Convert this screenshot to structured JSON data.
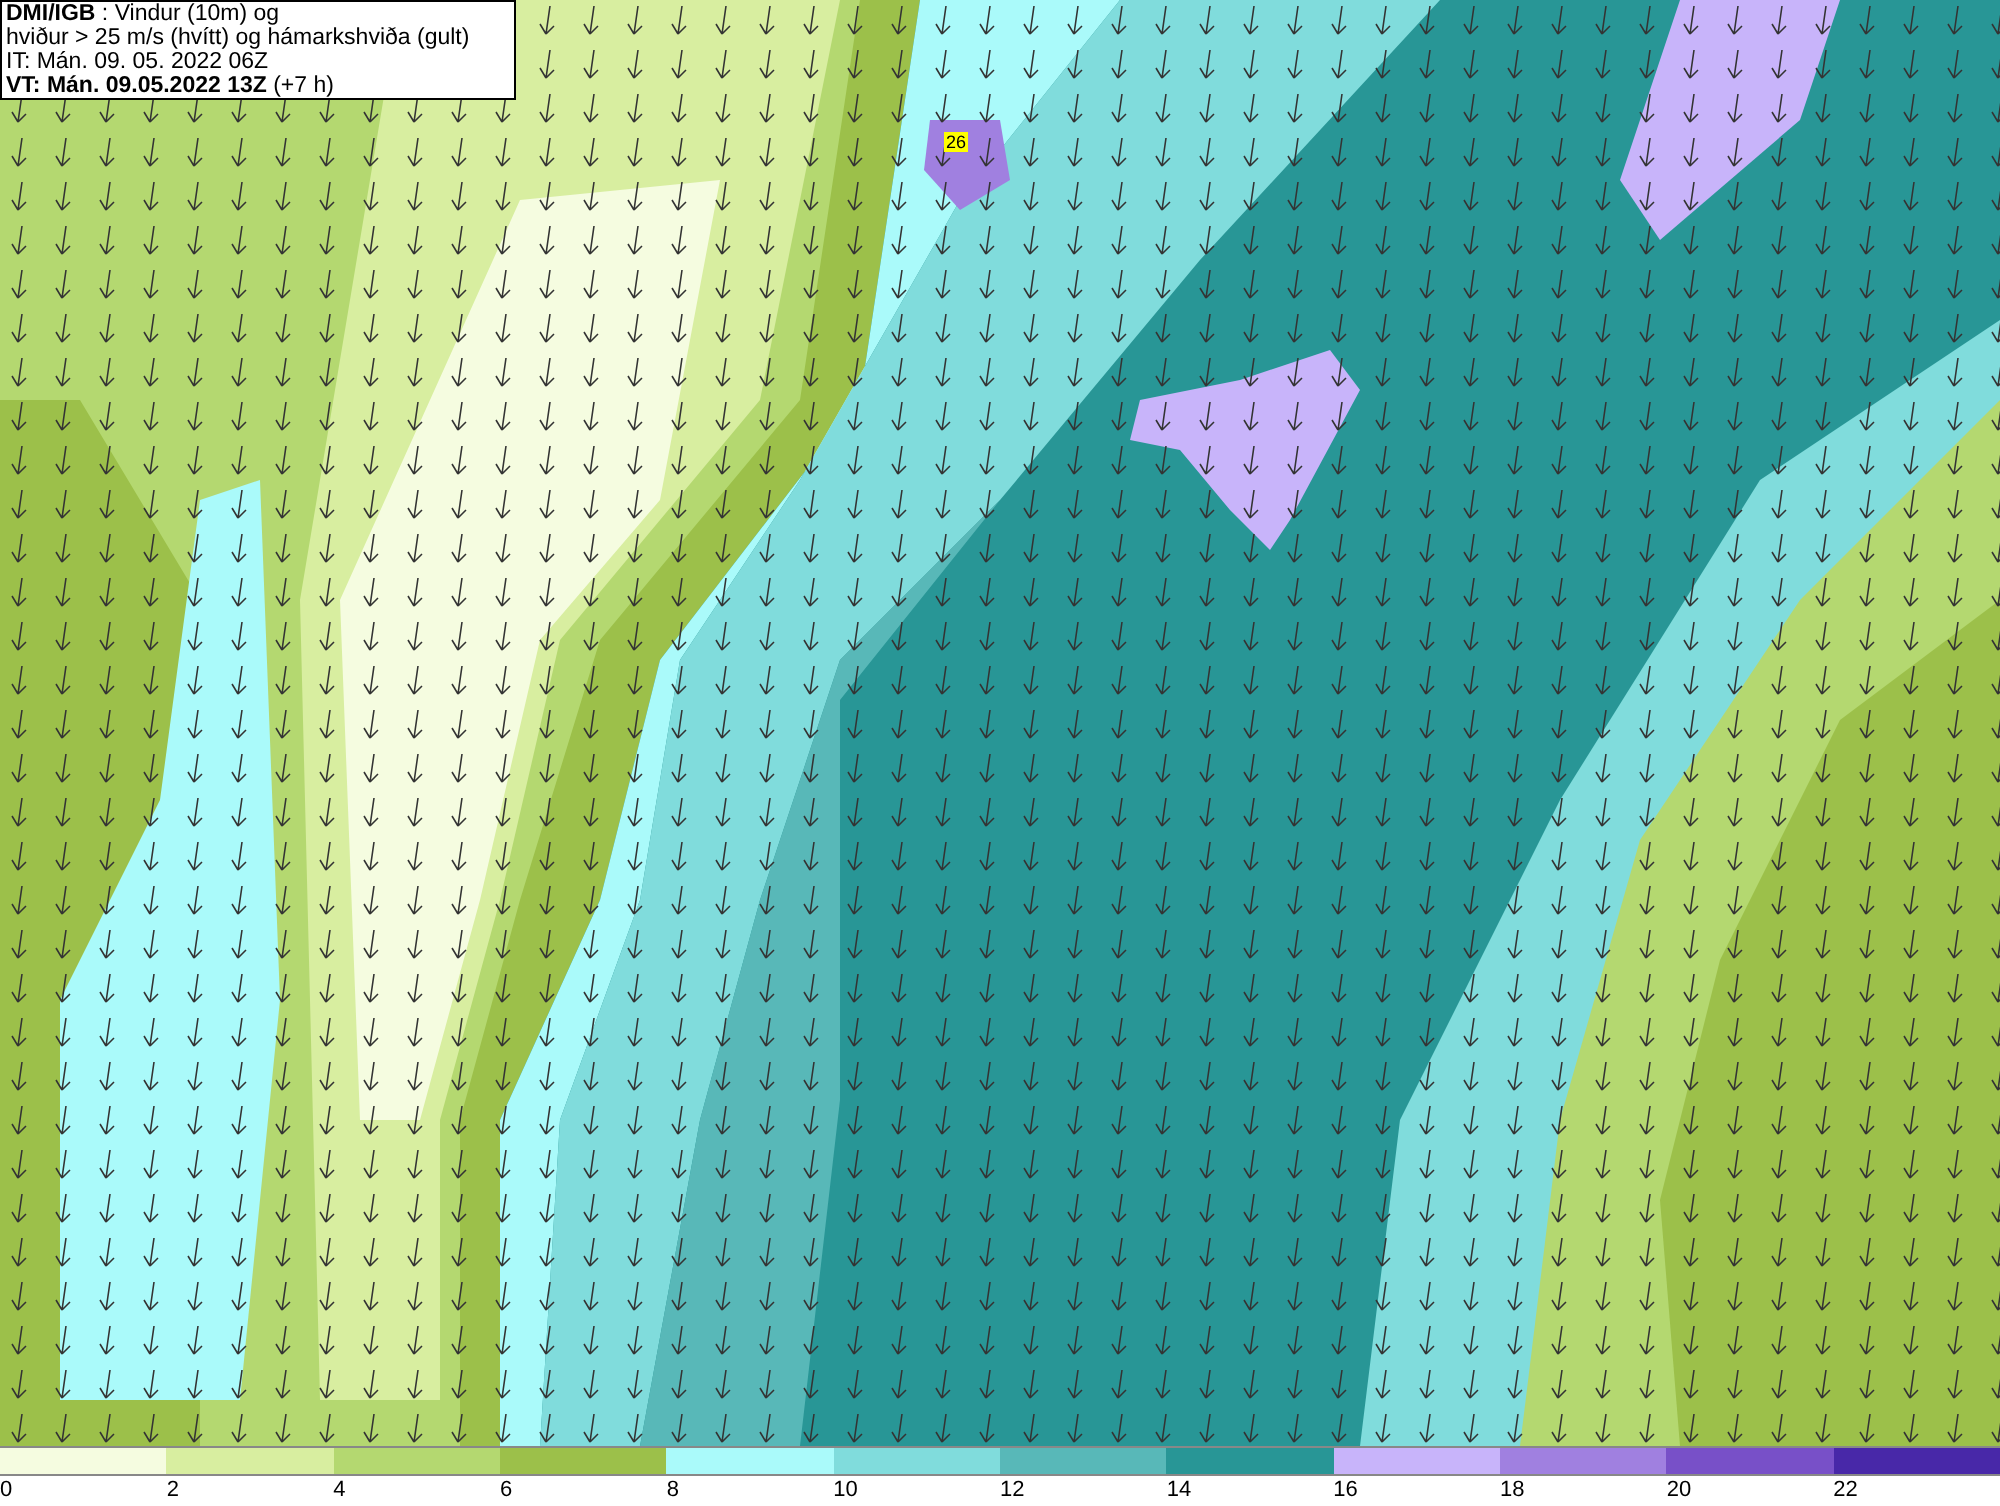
{
  "title_box": {
    "lines": [
      "**DMI/IGB** : Vindur (10m) og",
      "hviður > 25 m/s (hvítt) og hámarkshviða (gult)",
      "IT: Mán. 09. 05. 2022 06Z",
      "**VT: Mán. 09.05.2022 13Z** (+7 h)"
    ]
  },
  "map": {
    "max_gust_label": "26"
  },
  "legend": [
    {
      "label": "0",
      "color": "#f5fce0"
    },
    {
      "label": "2",
      "color": "#d8eea0"
    },
    {
      "label": "4",
      "color": "#b4d870"
    },
    {
      "label": "6",
      "color": "#9cc04a"
    },
    {
      "label": "8",
      "color": "#aafafa"
    },
    {
      "label": "10",
      "color": "#80dcdc"
    },
    {
      "label": "12",
      "color": "#58b8b8"
    },
    {
      "label": "14",
      "color": "#289696"
    },
    {
      "label": "16",
      "color": "#c8b4fa"
    },
    {
      "label": "18",
      "color": "#a080e0"
    },
    {
      "label": "20",
      "color": "#7850c8"
    },
    {
      "label": "22",
      "color": "#4828a8"
    }
  ]
}
